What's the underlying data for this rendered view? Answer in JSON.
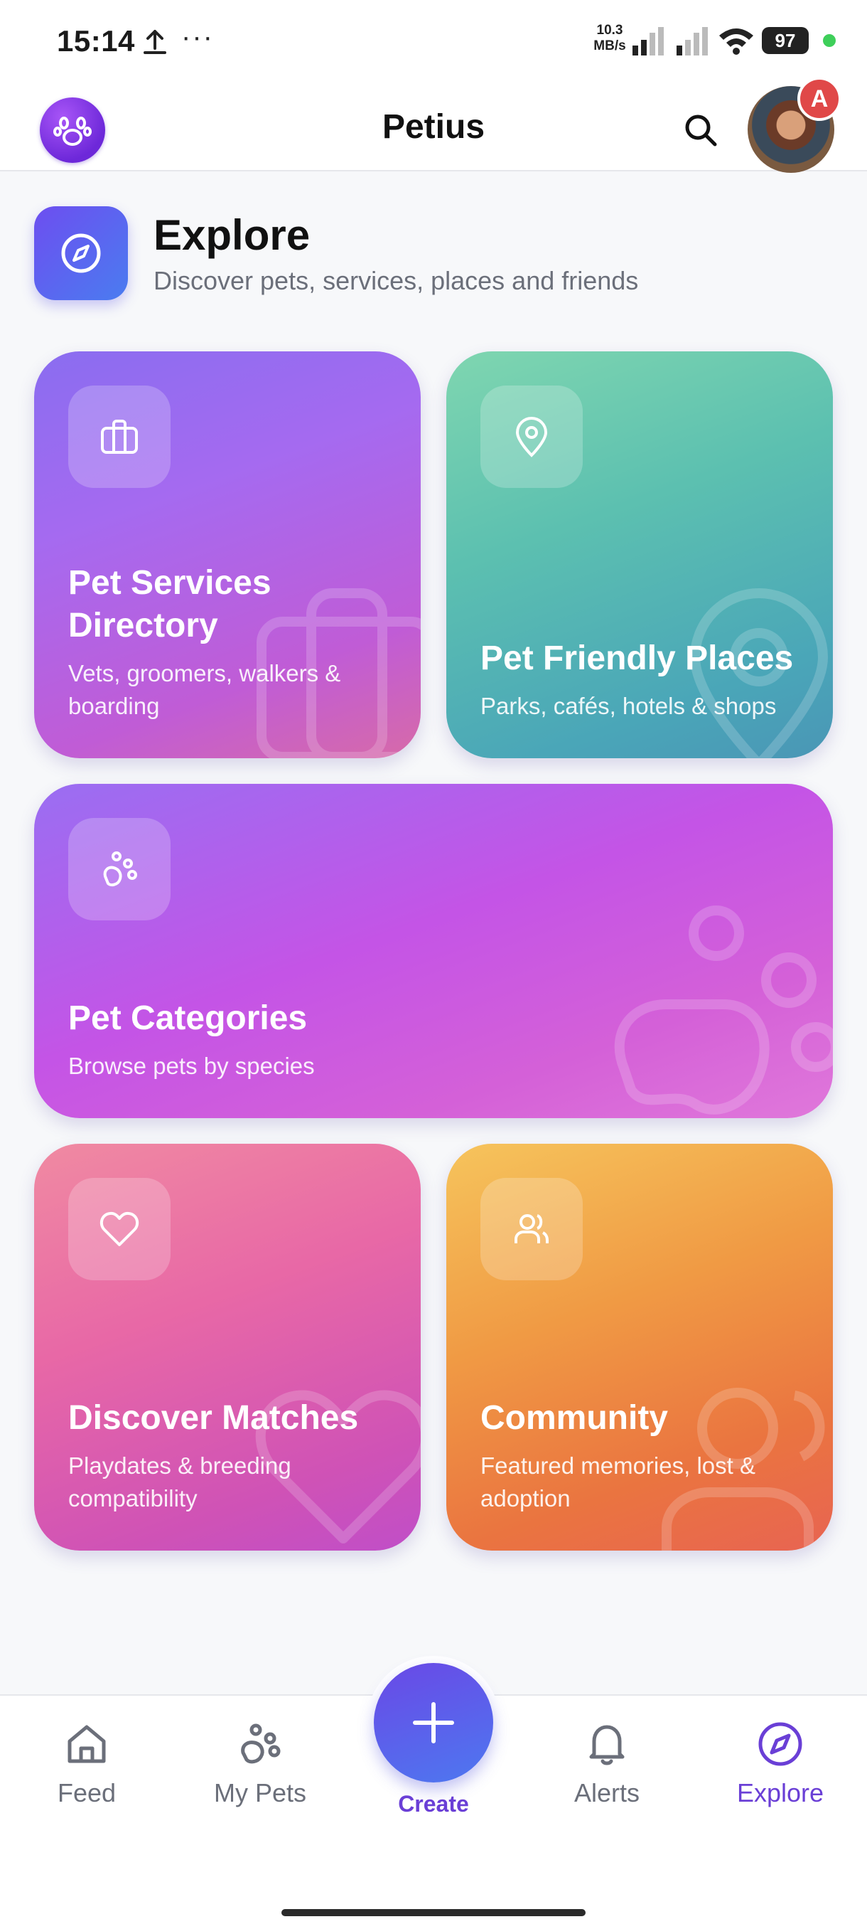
{
  "status_bar": {
    "time": "15:14",
    "more": "···",
    "speed_value": "10.3",
    "speed_unit": "MB/s",
    "battery": "97"
  },
  "header": {
    "title": "Petius",
    "notification_badge": "A"
  },
  "page": {
    "title": "Explore",
    "subtitle": "Discover pets, services, places and friends"
  },
  "cards": [
    {
      "title": "Pet Services Directory",
      "desc": "Vets, groomers, walkers & boarding",
      "icon": "briefcase-icon"
    },
    {
      "title": "Pet Friendly Places",
      "desc": "Parks, cafés, hotels & shops",
      "icon": "map-pin-icon"
    },
    {
      "title": "Pet Categories",
      "desc": "Browse pets by species",
      "icon": "paw-icon"
    },
    {
      "title": "Discover Matches",
      "desc": "Playdates & breeding compatibility",
      "icon": "heart-icon"
    },
    {
      "title": "Community",
      "desc": "Featured memories, lost & adoption",
      "icon": "users-icon"
    }
  ],
  "bottom_nav": {
    "items": [
      {
        "label": "Feed",
        "icon": "home-icon"
      },
      {
        "label": "My Pets",
        "icon": "paw-icon"
      },
      {
        "label": "Create",
        "icon": "plus-icon"
      },
      {
        "label": "Alerts",
        "icon": "bell-icon"
      },
      {
        "label": "Explore",
        "icon": "compass-icon",
        "active": true
      }
    ]
  },
  "colors": {
    "accent": "#6a3fd6",
    "services_card": "#a56af0",
    "places_card": "#5cc0b0",
    "categories_card": "#c454e6",
    "matches_card": "#e868a6",
    "community_card": "#f09a44",
    "badge": "#e04848"
  }
}
